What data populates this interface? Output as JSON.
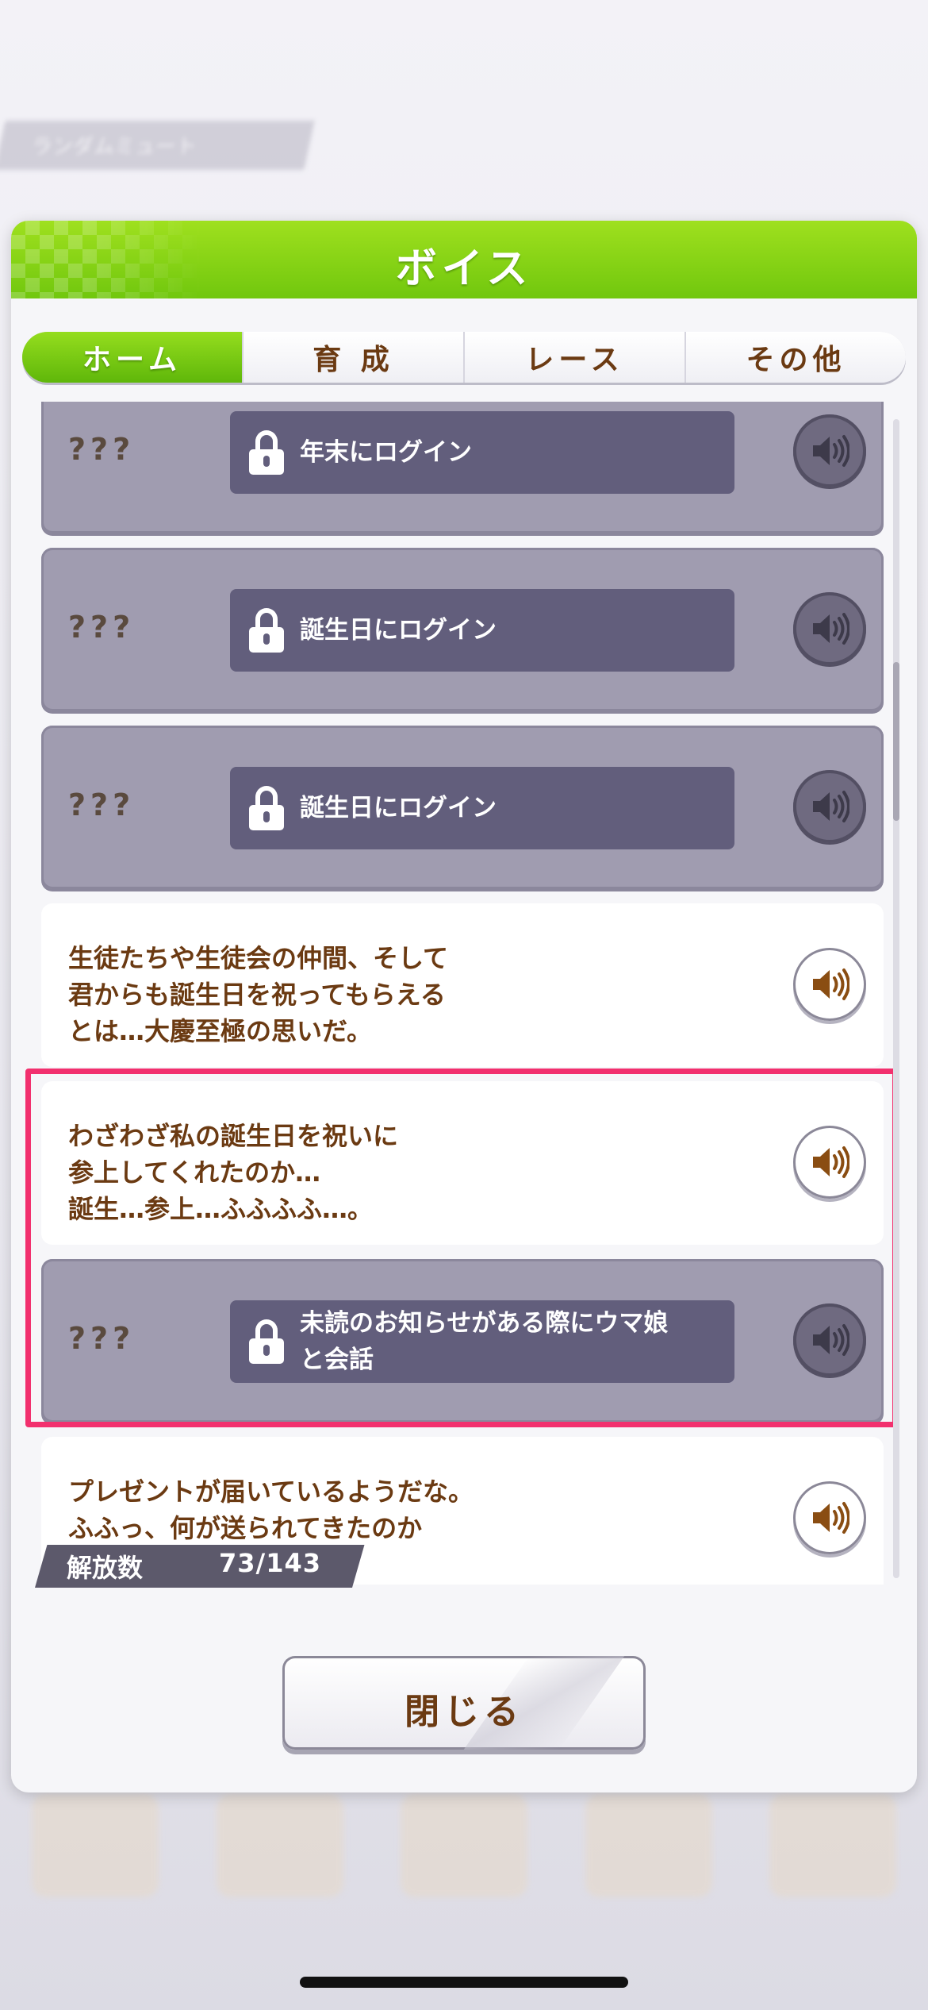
{
  "background": {
    "banner_text": "ランダムミュート"
  },
  "dialog": {
    "title": "ボイス",
    "close_label": "閉じる"
  },
  "tabs": [
    {
      "label": "ホーム",
      "active": true
    },
    {
      "label": "育 成",
      "active": false
    },
    {
      "label": "レース",
      "active": false
    },
    {
      "label": "その他",
      "active": false
    }
  ],
  "voices": [
    {
      "locked": true,
      "name": "???",
      "condition": "年末にログイン"
    },
    {
      "locked": true,
      "name": "???",
      "condition": "誕生日にログイン"
    },
    {
      "locked": true,
      "name": "???",
      "condition": "誕生日にログイン"
    },
    {
      "locked": false,
      "line": "生徒たちや生徒会の仲間、そして\n君からも誕生日を祝ってもらえる\nとは…大慶至極の思いだ。"
    },
    {
      "locked": false,
      "line": "わざわざ私の誕生日を祝いに\n参上してくれたのか…\n誕生…参上…ふふふふ…。"
    },
    {
      "locked": true,
      "name": "???",
      "condition": "未読のお知らせがある際にウマ娘\nと会話"
    },
    {
      "locked": false,
      "line": "プレゼントが届いているようだな。\nふふっ、何が送られてきたのか\n私も楽しみだ。"
    }
  ],
  "unlock_count": {
    "label": "解放数",
    "value": "73/143"
  },
  "colors": {
    "header_green": "#71c70e",
    "text_brown": "#6b3a12",
    "locked_card": "#a09cb0",
    "highlight": "#f2306e"
  },
  "icons": {
    "lock": "lock-icon",
    "play": "speaker-icon"
  }
}
